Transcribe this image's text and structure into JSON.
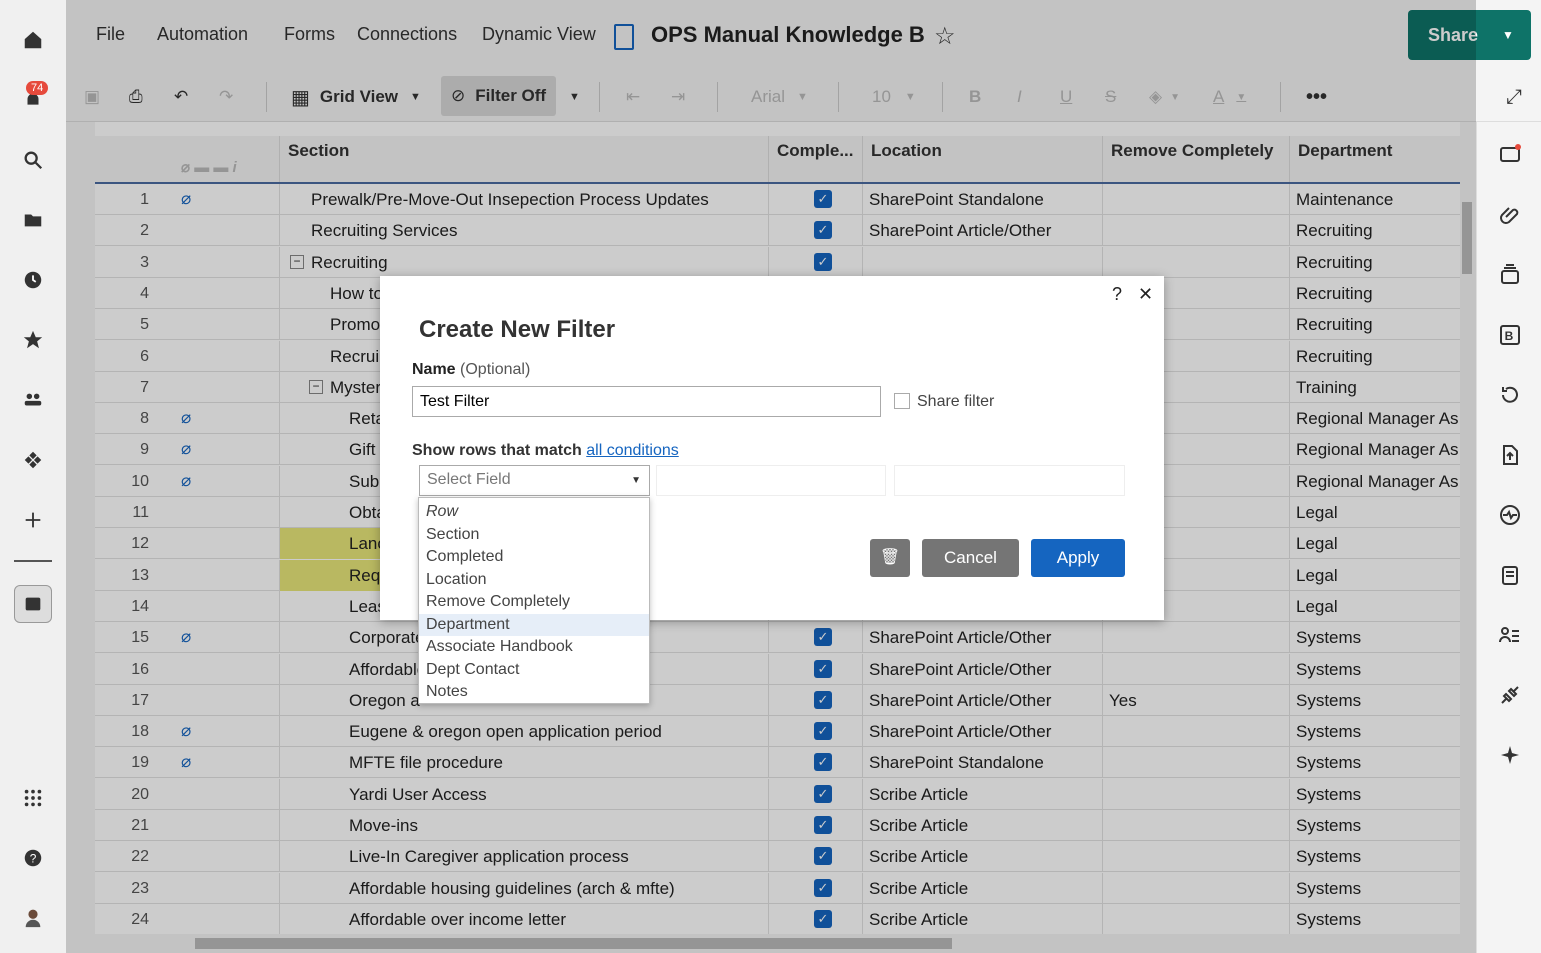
{
  "menu": {
    "file": "File",
    "automation": "Automation",
    "forms": "Forms",
    "connections": "Connections",
    "dynamic_view": "Dynamic View"
  },
  "doc_title": "OPS Manual Knowledge B",
  "share_label": "Share",
  "notification_count": "74",
  "toolbar": {
    "view": "Grid View",
    "filter": "Filter Off",
    "font": "Arial",
    "size": "10"
  },
  "columns": {
    "section": "Section",
    "completed": "Comple...",
    "location": "Location",
    "remove": "Remove Completely",
    "department": "Department"
  },
  "rows": [
    {
      "n": "1",
      "section": "Prewalk/Pre-Move-Out Insepection Process Updates",
      "loc": "SharePoint Standalone",
      "remove": "",
      "dept": "Maintenance",
      "attach": true,
      "check": true,
      "indent": 0
    },
    {
      "n": "2",
      "section": "Recruiting Services",
      "loc": "SharePoint Article/Other",
      "remove": "",
      "dept": "Recruiting",
      "attach": false,
      "check": true,
      "indent": 0
    },
    {
      "n": "3",
      "section": "Recruiting",
      "loc": "",
      "remove": "",
      "dept": "Recruiting",
      "attach": false,
      "check": true,
      "indent": 0,
      "collapse": true
    },
    {
      "n": "4",
      "section": "How to",
      "loc": "",
      "remove": "",
      "dept": "Recruiting",
      "attach": false,
      "check": false,
      "indent": 1
    },
    {
      "n": "5",
      "section": "Promo",
      "loc": "",
      "remove": "",
      "dept": "Recruiting",
      "attach": false,
      "check": false,
      "indent": 1
    },
    {
      "n": "6",
      "section": "Recrui",
      "loc": "",
      "remove": "",
      "dept": "Recruiting",
      "attach": false,
      "check": false,
      "indent": 1
    },
    {
      "n": "7",
      "section": "Myster",
      "loc": "",
      "remove": "",
      "dept": "Training",
      "attach": false,
      "check": false,
      "indent": 1,
      "collapse": true
    },
    {
      "n": "8",
      "section": "Reta",
      "loc": "",
      "remove": "",
      "dept": "Regional Manager As",
      "attach": true,
      "check": false,
      "indent": 2
    },
    {
      "n": "9",
      "section": "Gift",
      "loc": "",
      "remove": "",
      "dept": "Regional Manager As",
      "attach": true,
      "check": false,
      "indent": 2
    },
    {
      "n": "10",
      "section": "Subi",
      "loc": "",
      "remove": "",
      "dept": "Regional Manager As",
      "attach": true,
      "check": false,
      "indent": 2
    },
    {
      "n": "11",
      "section": "Obta",
      "loc": "",
      "remove": "",
      "dept": "Legal",
      "attach": false,
      "check": false,
      "indent": 2
    },
    {
      "n": "12",
      "section": "Lanc",
      "loc": "",
      "remove": "",
      "dept": "Legal",
      "attach": false,
      "check": false,
      "indent": 2,
      "hl": true
    },
    {
      "n": "13",
      "section": "Req",
      "loc": "",
      "remove": "",
      "dept": "Legal",
      "attach": false,
      "check": false,
      "indent": 2,
      "hl": true
    },
    {
      "n": "14",
      "section": "Leas",
      "loc": "",
      "remove": "",
      "dept": "Legal",
      "attach": false,
      "check": false,
      "indent": 2
    },
    {
      "n": "15",
      "section": "Corporate",
      "loc": "SharePoint Article/Other",
      "remove": "",
      "dept": "Systems",
      "attach": true,
      "check": true,
      "indent": 2
    },
    {
      "n": "16",
      "section": "Affordable",
      "loc": "SharePoint Article/Other",
      "remove": "",
      "dept": "Systems",
      "attach": false,
      "check": true,
      "indent": 2
    },
    {
      "n": "17",
      "section": "Oregon a",
      "loc": "SharePoint Article/Other",
      "remove": "Yes",
      "dept": "Systems",
      "attach": false,
      "check": true,
      "indent": 2
    },
    {
      "n": "18",
      "section": "Eugene & oregon open application period",
      "loc": "SharePoint Article/Other",
      "remove": "",
      "dept": "Systems",
      "attach": true,
      "check": true,
      "indent": 2
    },
    {
      "n": "19",
      "section": "MFTE file procedure",
      "loc": "SharePoint Standalone",
      "remove": "",
      "dept": "Systems",
      "attach": true,
      "check": true,
      "indent": 2
    },
    {
      "n": "20",
      "section": "Yardi User Access",
      "loc": "Scribe Article",
      "remove": "",
      "dept": "Systems",
      "attach": false,
      "check": true,
      "indent": 2
    },
    {
      "n": "21",
      "section": "Move-ins",
      "loc": "Scribe Article",
      "remove": "",
      "dept": "Systems",
      "attach": false,
      "check": true,
      "indent": 2
    },
    {
      "n": "22",
      "section": "Live-In Caregiver application process",
      "loc": "Scribe Article",
      "remove": "",
      "dept": "Systems",
      "attach": false,
      "check": true,
      "indent": 2
    },
    {
      "n": "23",
      "section": "Affordable housing guidelines (arch & mfte)",
      "loc": "Scribe Article",
      "remove": "",
      "dept": "Systems",
      "attach": false,
      "check": true,
      "indent": 2
    },
    {
      "n": "24",
      "section": "Affordable over income letter",
      "loc": "Scribe Article",
      "remove": "",
      "dept": "Systems",
      "attach": false,
      "check": true,
      "indent": 2
    }
  ],
  "dialog": {
    "title": "Create New Filter",
    "name_label": "Name",
    "name_optional": "(Optional)",
    "name_value": "Test Filter",
    "share_filter": "Share filter",
    "match_prefix": "Show rows that match",
    "match_link": "all conditions",
    "select_placeholder": "Select Field",
    "cancel": "Cancel",
    "apply": "Apply",
    "help": "?",
    "close": "✕"
  },
  "field_options": [
    "Row",
    "Section",
    "Completed",
    "Location",
    "Remove Completely",
    "Department",
    "Associate Handbook",
    "Dept Contact",
    "Notes"
  ]
}
